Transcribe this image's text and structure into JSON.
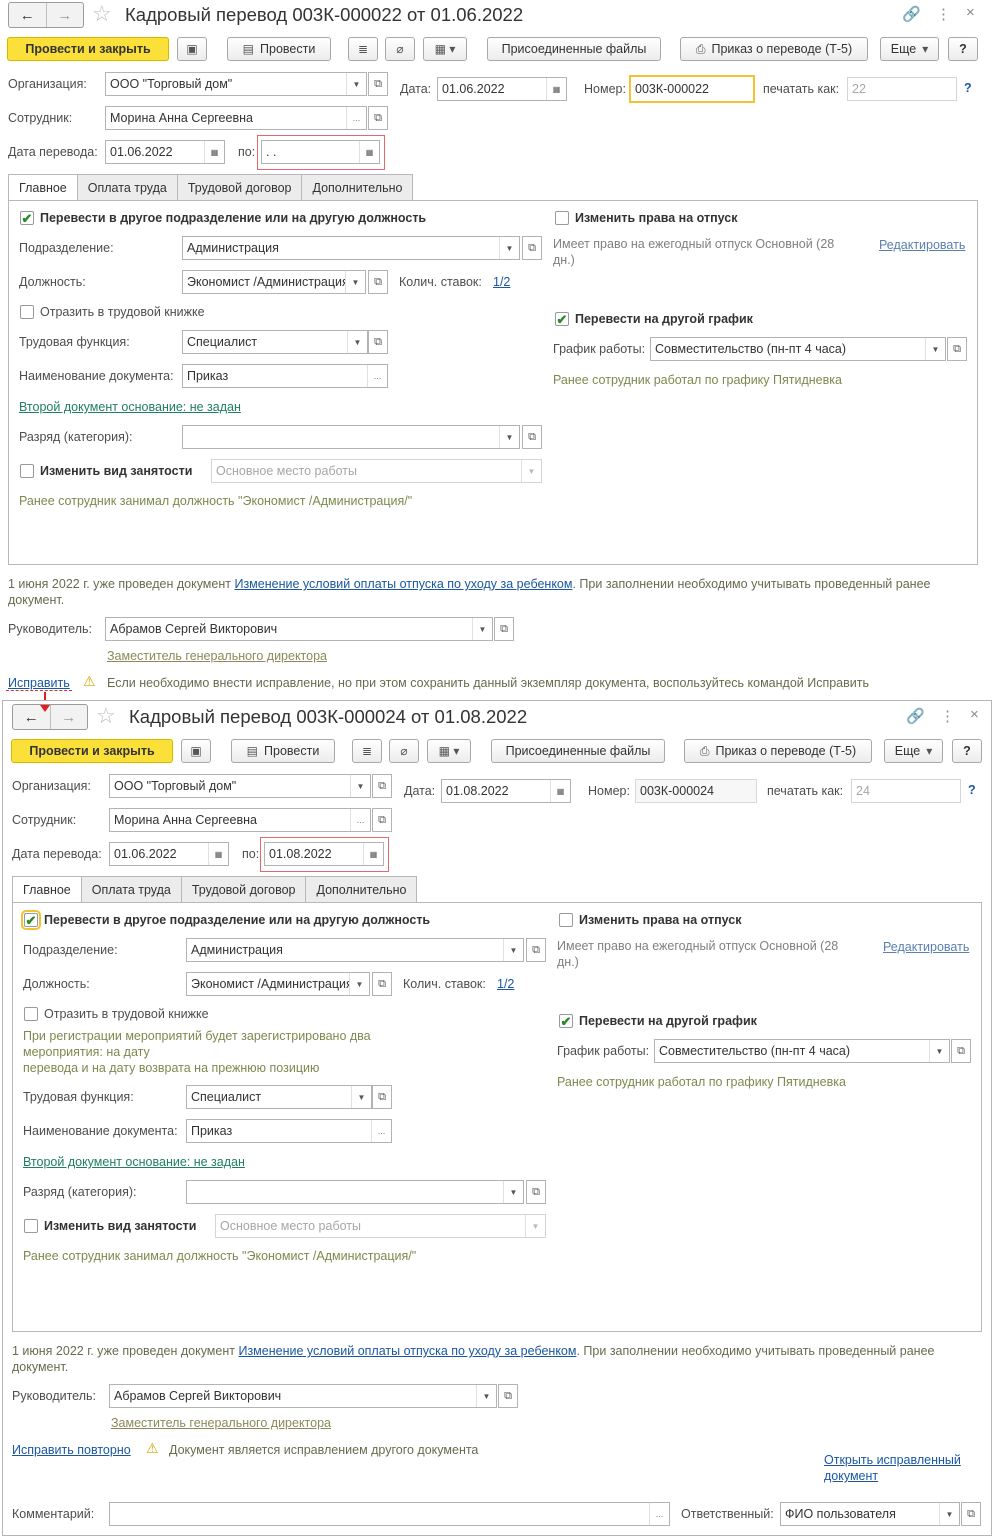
{
  "w1": {
    "title": "Кадровый перевод 003К-000022 от 01.06.2022",
    "toolbar": {
      "post_close": "Провести и закрыть",
      "post": "Провести",
      "attached": "Присоединенные файлы",
      "order": "Приказ о переводе (Т-5)",
      "more": "Еще",
      "help": "?"
    },
    "org_label": "Организация:",
    "org_value": "ООО \"Торговый дом\"",
    "date_label": "Дата:",
    "date_value": "01.06.2022",
    "number_label": "Номер:",
    "number_value": "003К-000022",
    "print_as_label": "печатать как:",
    "print_as_value": "22",
    "employee_label": "Сотрудник:",
    "employee_value": "Морина Анна Сергеевна",
    "transfer_date_label": "Дата перевода:",
    "transfer_date_value": "01.06.2022",
    "to_label": "по:",
    "to_value": " .  .",
    "tabs": [
      "Главное",
      "Оплата труда",
      "Трудовой договор",
      "Дополнительно"
    ],
    "transfer_cb": "Перевести в другое подразделение или на другую должность",
    "dept_label": "Подразделение:",
    "dept_value": "Администрация",
    "pos_label": "Должность:",
    "pos_value": "Экономист /Администрация/",
    "rates_label": "Колич. ставок:",
    "rates_value": "1/2",
    "workbook_cb": "Отразить в трудовой книжке",
    "func_label": "Трудовая функция:",
    "func_value": "Специалист",
    "docname_label": "Наименование документа:",
    "docname_value": "Приказ",
    "second_doc": "Второй документ основание: не задан",
    "rank_label": "Разряд (категория):",
    "rank_value": "",
    "employment_cb": "Изменить вид занятости",
    "employment_value": "Основное место работы",
    "prev_pos": "Ранее сотрудник занимал должность \"Экономист /Администрация/\"",
    "vacation_cb": "Изменить права на отпуск",
    "vacation_note": "Имеет право на ежегодный отпуск Основной (28 дн.)",
    "edit_link": "Редактировать",
    "schedule_cb": "Перевести на другой график",
    "schedule_label": "График работы:",
    "schedule_value": "Совместительство (пн-пт 4 часа)",
    "prev_schedule": "Ранее сотрудник работал по графику Пятидневка",
    "info_pre": "1 июня 2022 г. уже проведен документ ",
    "info_link": "Изменение условий оплаты отпуска по уходу за ребенком",
    "info_post": ". При заполнении необходимо учитывать проведенный ранее документ.",
    "manager_label": "Руководитель:",
    "manager_value": "Абрамов Сергей Викторович",
    "manager_pos": "Заместитель генерального директора",
    "fix_link": "Исправить",
    "fix_note": "Если необходимо внести исправление, но при этом сохранить данный экземпляр документа, воспользуйтесь командой Исправить"
  },
  "w2": {
    "title": "Кадровый перевод 003К-000024 от 01.08.2022",
    "toolbar": {
      "post_close": "Провести и закрыть",
      "post": "Провести",
      "attached": "Присоединенные файлы",
      "order": "Приказ о переводе (Т-5)",
      "more": "Еще",
      "help": "?"
    },
    "org_label": "Организация:",
    "org_value": "ООО \"Торговый дом\"",
    "date_label": "Дата:",
    "date_value": "01.08.2022",
    "number_label": "Номер:",
    "number_value": "003К-000024",
    "print_as_label": "печатать как:",
    "print_as_value": "24",
    "employee_label": "Сотрудник:",
    "employee_value": "Морина Анна Сергеевна",
    "transfer_date_label": "Дата перевода:",
    "transfer_date_value": "01.06.2022",
    "to_label": "по:",
    "to_value": "01.08.2022",
    "tabs": [
      "Главное",
      "Оплата труда",
      "Трудовой договор",
      "Дополнительно"
    ],
    "transfer_cb": "Перевести в другое подразделение или на другую должность",
    "dept_label": "Подразделение:",
    "dept_value": "Администрация",
    "pos_label": "Должность:",
    "pos_value": "Экономист /Администрация/",
    "rates_label": "Колич. ставок:",
    "rates_value": "1/2",
    "workbook_cb": "Отразить в трудовой книжке",
    "events_note1": "При регистрации мероприятий будет зарегистрировано два",
    "events_note2": "мероприятия: на дату",
    "events_note3": "перевода и на дату возврата на прежнюю позицию",
    "func_label": "Трудовая функция:",
    "func_value": "Специалист",
    "docname_label": "Наименование документа:",
    "docname_value": "Приказ",
    "second_doc": "Второй документ основание: не задан",
    "rank_label": "Разряд (категория):",
    "rank_value": "",
    "employment_cb": "Изменить вид занятости",
    "employment_value": "Основное место работы",
    "prev_pos": "Ранее сотрудник занимал должность \"Экономист /Администрация/\"",
    "vacation_cb": "Изменить права на отпуск",
    "vacation_note": "Имеет право на ежегодный отпуск Основной (28 дн.)",
    "edit_link": "Редактировать",
    "schedule_cb": "Перевести на другой график",
    "schedule_label": "График работы:",
    "schedule_value": "Совместительство (пн-пт 4 часа)",
    "prev_schedule": "Ранее сотрудник работал по графику Пятидневка",
    "info_pre": "1 июня 2022 г. уже проведен документ ",
    "info_link": "Изменение условий оплаты отпуска по уходу за ребенком",
    "info_post": ". При заполнении необходимо учитывать проведенный ранее документ.",
    "manager_label": "Руководитель:",
    "manager_value": "Абрамов Сергей Викторович",
    "manager_pos": "Заместитель генерального директора",
    "fix_again_link": "Исправить повторно",
    "fix_note": "Документ является исправлением другого документа",
    "open_fixed_link1": "Открыть исправленный",
    "open_fixed_link2": "документ",
    "comment_label": "Комментарий:",
    "comment_value": "",
    "responsible_label": "Ответственный:",
    "responsible_value": "ФИО пользователя"
  },
  "icons": {
    "back": "←",
    "forward": "→",
    "star": "☆",
    "link": "🔗",
    "menu": "⋮",
    "close": "×",
    "save": "💾",
    "dropdown": "▾",
    "open": "⧉",
    "calendar": "📅",
    "check": "✔",
    "warning": "⚠",
    "help": "?"
  }
}
